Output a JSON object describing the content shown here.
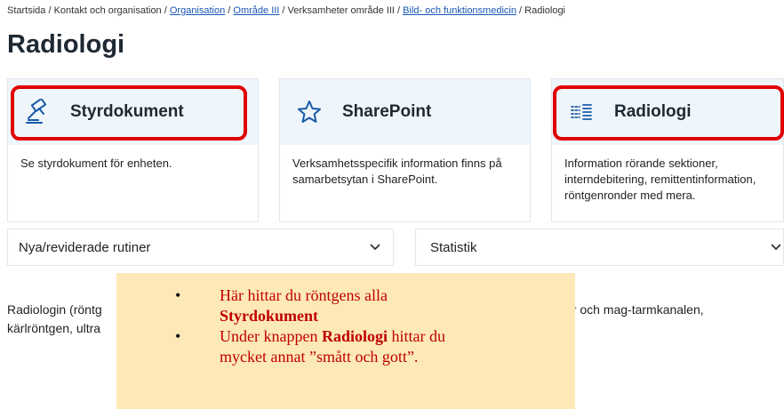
{
  "breadcrumb": {
    "items": [
      {
        "label": "Startsida",
        "link": false
      },
      {
        "label": "Kontakt och organisation",
        "link": false
      },
      {
        "label": "Organisation",
        "link": true
      },
      {
        "label": "Område III",
        "link": true
      },
      {
        "label": "Verksamheter område III",
        "link": false
      },
      {
        "label": "Bild- och funktionsmedicin",
        "link": true
      },
      {
        "label": "Radiologi",
        "link": false
      }
    ],
    "separator": " / "
  },
  "page_title": "Radiologi",
  "cards": [
    {
      "title": "Styrdokument",
      "icon": "gavel-icon",
      "description": "Se styrdokument för enheten."
    },
    {
      "title": "SharePoint",
      "icon": "star-icon",
      "description": "Verksamhetsspecifik information finns på samarbetsytan i SharePoint."
    },
    {
      "title": "Radiologi",
      "icon": "list-icon",
      "description": "Information rörande sektioner, interndebitering, remittentinformation, röntgenronder med mera."
    }
  ],
  "dropdowns": [
    {
      "label": "Nya/reviderade rutiner",
      "icon": "chevron-down-icon"
    },
    {
      "label": "Statistik",
      "icon": "chevron-down-icon"
    }
  ],
  "intro": {
    "line1_left": "Radiologin (röntg",
    "line1_right": "ar och mag-tarmkanalen,",
    "line2_left": "kärlröntgen, ultra"
  },
  "note": {
    "bullet1_text": "Här hittar du röntgens alla",
    "bullet1_bold": "Styrdokument",
    "bullet2_pre": "Under knappen ",
    "bullet2_bold": "Radiologi",
    "bullet2_post": " hittar du",
    "bullet2_line2": "mycket annat ”smått och gott”."
  },
  "colors": {
    "highlight": "#e00000",
    "note_background": "#fde9b8",
    "note_text": "#c00000",
    "link": "#1a56b8",
    "card_head": "#eef6fb",
    "icon": "#1a5aa8"
  }
}
